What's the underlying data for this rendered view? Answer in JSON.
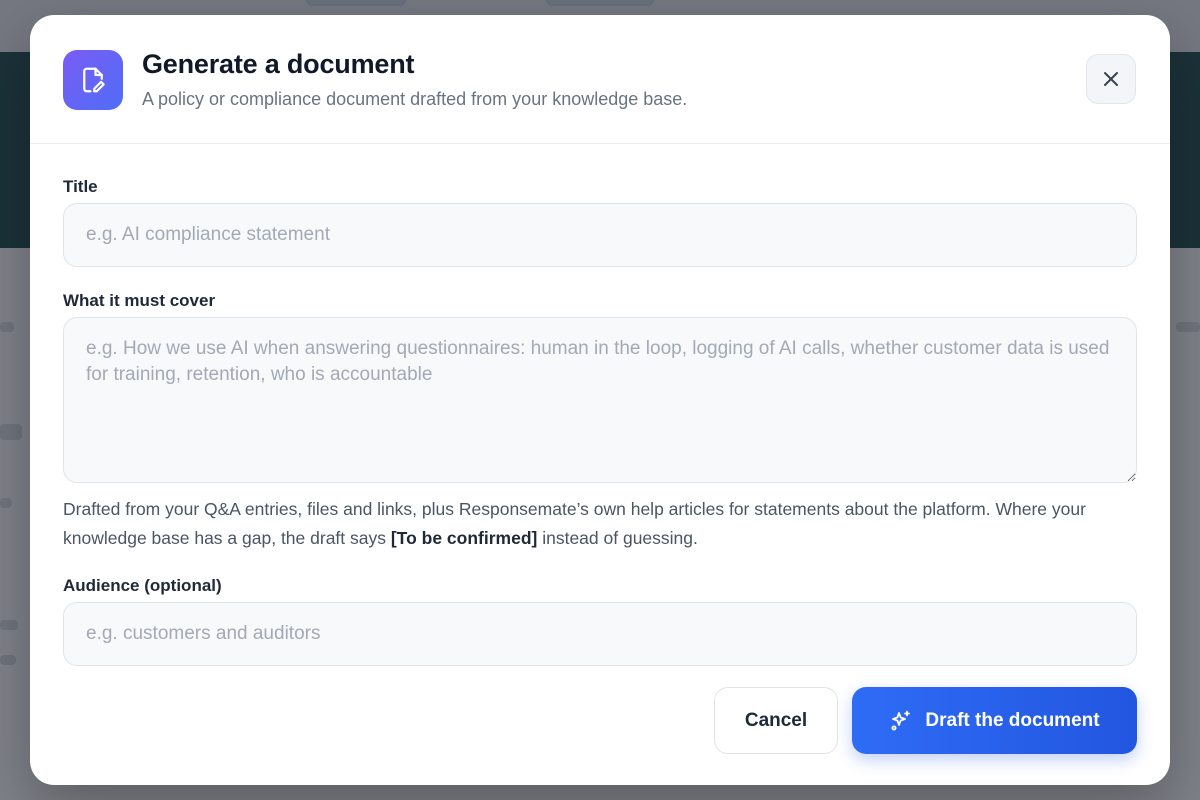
{
  "modal": {
    "title": "Generate a document",
    "subtitle": "A policy or compliance document drafted from your knowledge base.",
    "header_icon": "document-edit-icon",
    "close_icon": "close-icon"
  },
  "form": {
    "title_field": {
      "label": "Title",
      "value": "",
      "placeholder": "e.g. AI compliance statement"
    },
    "cover_field": {
      "label": "What it must cover",
      "value": "",
      "placeholder": "e.g. How we use AI when answering questionnaires: human in the loop, logging of AI calls, whether customer data is used for training, retention, who is accountable"
    },
    "help": {
      "before": "Drafted from your Q&A entries, files and links, plus Responsemate’s own help articles for statements about the platform. Where your knowledge base has a gap, the draft says ",
      "emphasis": "[To be confirmed]",
      "after": " instead of guessing."
    },
    "audience_field": {
      "label": "Audience (optional)",
      "value": "",
      "placeholder": "e.g. customers and auditors"
    }
  },
  "actions": {
    "cancel_label": "Cancel",
    "submit_label": "Draft the document",
    "submit_icon": "sparkles-icon"
  },
  "colors": {
    "accent": "#2f6cf6",
    "icon_gradient_start": "#7b5cf6",
    "icon_gradient_end": "#4f6df5"
  }
}
